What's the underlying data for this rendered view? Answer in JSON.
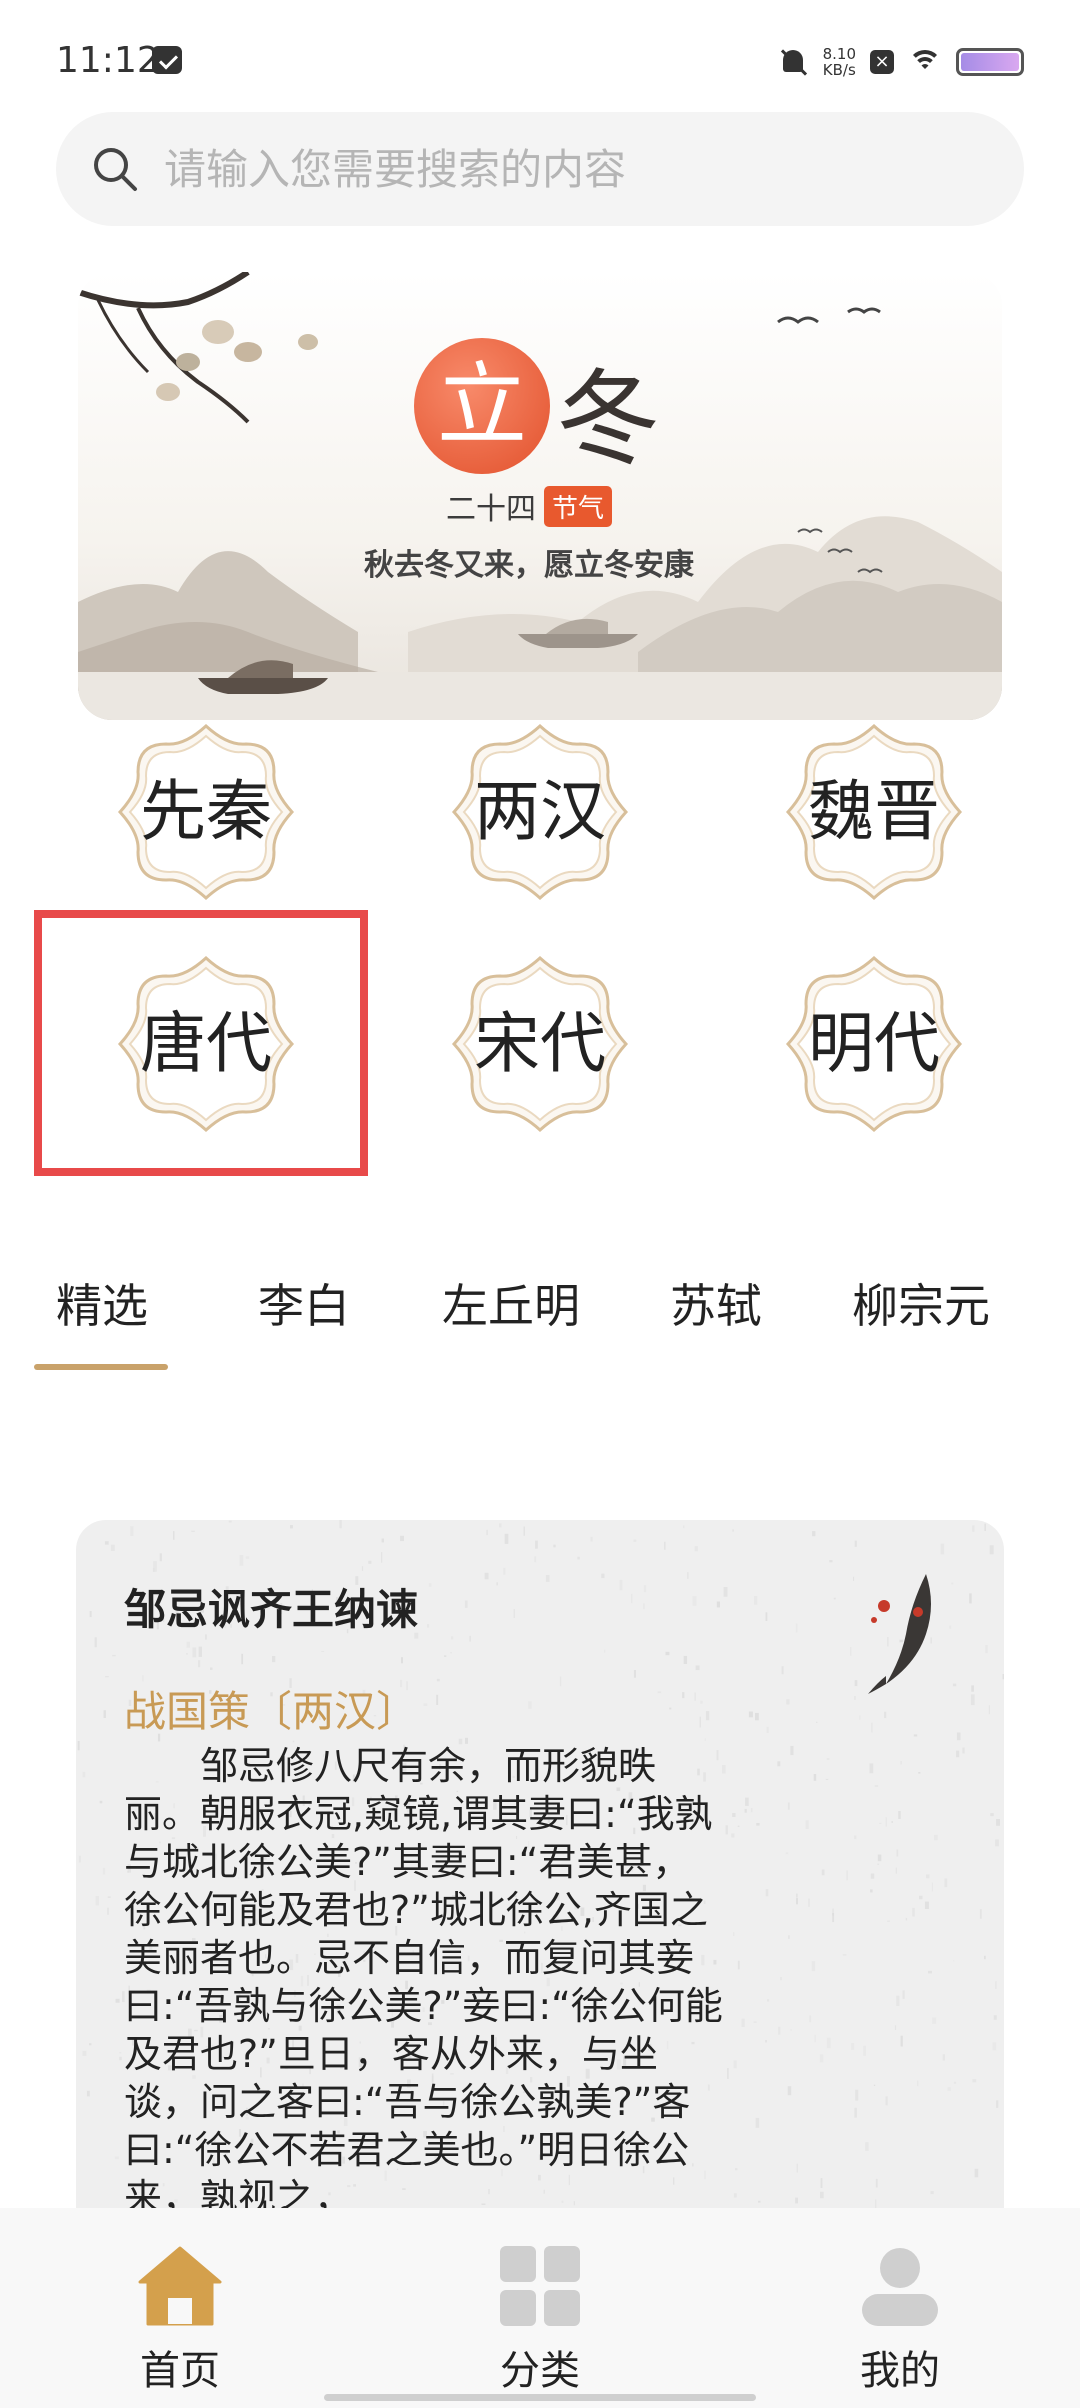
{
  "status_bar": {
    "time": "11:12",
    "net_speed_value": "8.10",
    "net_speed_unit": "KB/s",
    "icons": [
      "message-icon",
      "mute-bell-icon",
      "close-box-icon",
      "wifi-icon",
      "battery-icon"
    ]
  },
  "search": {
    "placeholder": "请输入您需要搜索的内容"
  },
  "banner": {
    "title_first": "立",
    "title_second": "冬",
    "subtitle_prefix": "二十四",
    "subtitle_badge": "节气",
    "slogan": "秋去冬又来，愿立冬安康"
  },
  "dynasties": [
    {
      "label": "先秦"
    },
    {
      "label": "两汉"
    },
    {
      "label": "魏晋"
    },
    {
      "label": "唐代"
    },
    {
      "label": "宋代"
    },
    {
      "label": "明代"
    }
  ],
  "tabs": [
    {
      "label": "精选",
      "active": true
    },
    {
      "label": "李白"
    },
    {
      "label": "左丘明"
    },
    {
      "label": "苏轼"
    },
    {
      "label": "柳宗元"
    }
  ],
  "card": {
    "title": "邹忌讽齐王纳谏",
    "source": "战国策〔两汉〕",
    "text": "邹忌修八尺有余，而形貌昳丽。朝服衣冠,窥镜,谓其妻曰:“我孰与城北徐公美?”其妻曰:“君美甚，徐公何能及君也?”城北徐公,齐国之美丽者也。忌不自信，而复问其妾曰:“吾孰与徐公美?”妾曰:“徐公何能及君也?”旦日，客从外来，与坐谈，问之客曰:“吾与徐公孰美?”客曰:“徐公不若君之美也。”明日徐公来，孰视之，"
  },
  "bottom_nav": [
    {
      "label": "首页",
      "icon": "home-icon",
      "active": true
    },
    {
      "label": "分类",
      "icon": "grid-icon"
    },
    {
      "label": "我的",
      "icon": "user-icon"
    }
  ],
  "colors": {
    "accent_gold": "#c9a26a",
    "highlight_red": "#e84a4a",
    "banner_red": "#e2512c"
  }
}
